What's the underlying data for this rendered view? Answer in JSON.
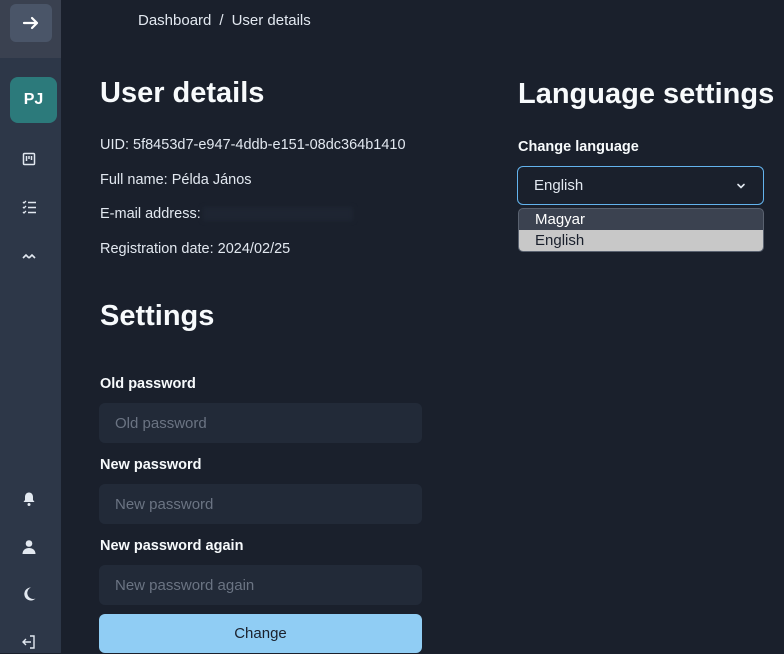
{
  "breadcrumb": {
    "home": "Dashboard",
    "separator": "/",
    "current": "User details"
  },
  "sidebar": {
    "avatar_initials": "PJ",
    "icons": [
      "arrow-right-icon",
      "board-icon",
      "list-icon",
      "chevrons-icon",
      "bell-icon",
      "user-icon",
      "moon-icon",
      "logout-icon"
    ]
  },
  "user_details": {
    "title": "User details",
    "uid": "UID: 5f8453d7-e947-4ddb-e151-08dc364b1410",
    "full_name": "Full name: Példa János",
    "email_label": "E-mail address:",
    "registration": "Registration date: 2024/02/25"
  },
  "settings": {
    "title": "Settings",
    "old_password_label": "Old password",
    "old_password_placeholder": "Old password",
    "new_password_label": "New password",
    "new_password_placeholder": "New password",
    "new_password_again_label": "New password again",
    "new_password_again_placeholder": "New password again",
    "change_button": "Change"
  },
  "language": {
    "title": "Language settings",
    "label": "Change language",
    "selected": "English",
    "options": [
      "Magyar",
      "English"
    ]
  },
  "colors": {
    "background": "#1a202c",
    "sidebar": "#2d3748",
    "accent": "#90cdf4",
    "avatar": "#2c7a7b"
  }
}
